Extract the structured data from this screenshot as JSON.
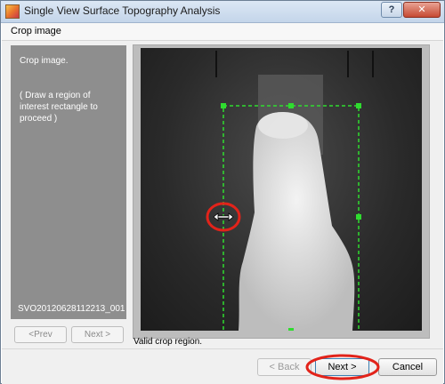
{
  "window": {
    "title": "Single View Surface Topography Analysis",
    "help_label": "?",
    "close_label": "✕"
  },
  "section": {
    "header": "Crop image"
  },
  "left_panel": {
    "heading": "Crop image.",
    "instruction": "( Draw a region of interest rectangle to proceed )",
    "dataset_id": "SVO20120628112213_001",
    "prev_label": "<Prev",
    "next_label": "Next >"
  },
  "image": {
    "status": "Valid crop region.",
    "cursor_icon": "resize-horizontal-icon",
    "annotation_color": "#e2231a",
    "crop_color": "#2fdc2f"
  },
  "footer": {
    "back_label": "< Back",
    "next_label": "Next >",
    "cancel_label": "Cancel"
  }
}
